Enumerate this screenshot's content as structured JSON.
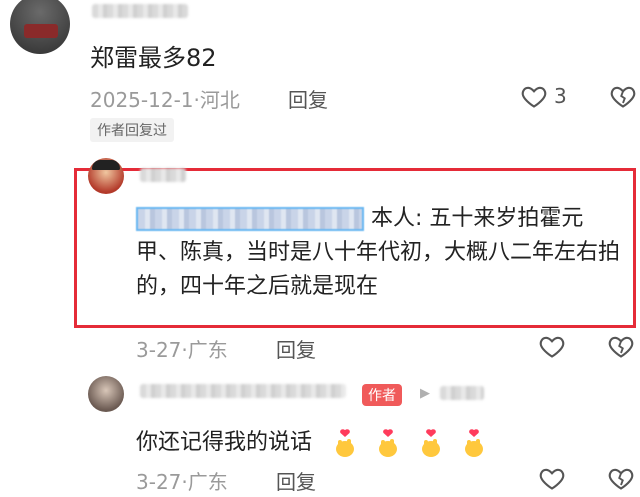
{
  "comment1": {
    "text": "郑雷最多82",
    "date_location": "2025-12-1·河北",
    "reply_label": "回复",
    "like_count": "3",
    "author_replied_tag": "作者回复过"
  },
  "reply1": {
    "body_rest": "本人: 五十来岁拍霍元甲、陈真，当时是八十年代初，大概八二年左右拍的，四十年之后就是现在",
    "date_location": "3-27·广东",
    "reply_label": "回复"
  },
  "reply2": {
    "author_badge": "作者",
    "arrow": "▶",
    "text": "你还记得我的说话",
    "emojis": [
      "🫰",
      "🫰",
      "🫰",
      "🫰"
    ],
    "date_location": "3-27·广东",
    "reply_label": "回复"
  },
  "colors": {
    "highlight": "#e52b38",
    "author_badge": "#f05a5a",
    "mention_border": "#69b7f2"
  }
}
